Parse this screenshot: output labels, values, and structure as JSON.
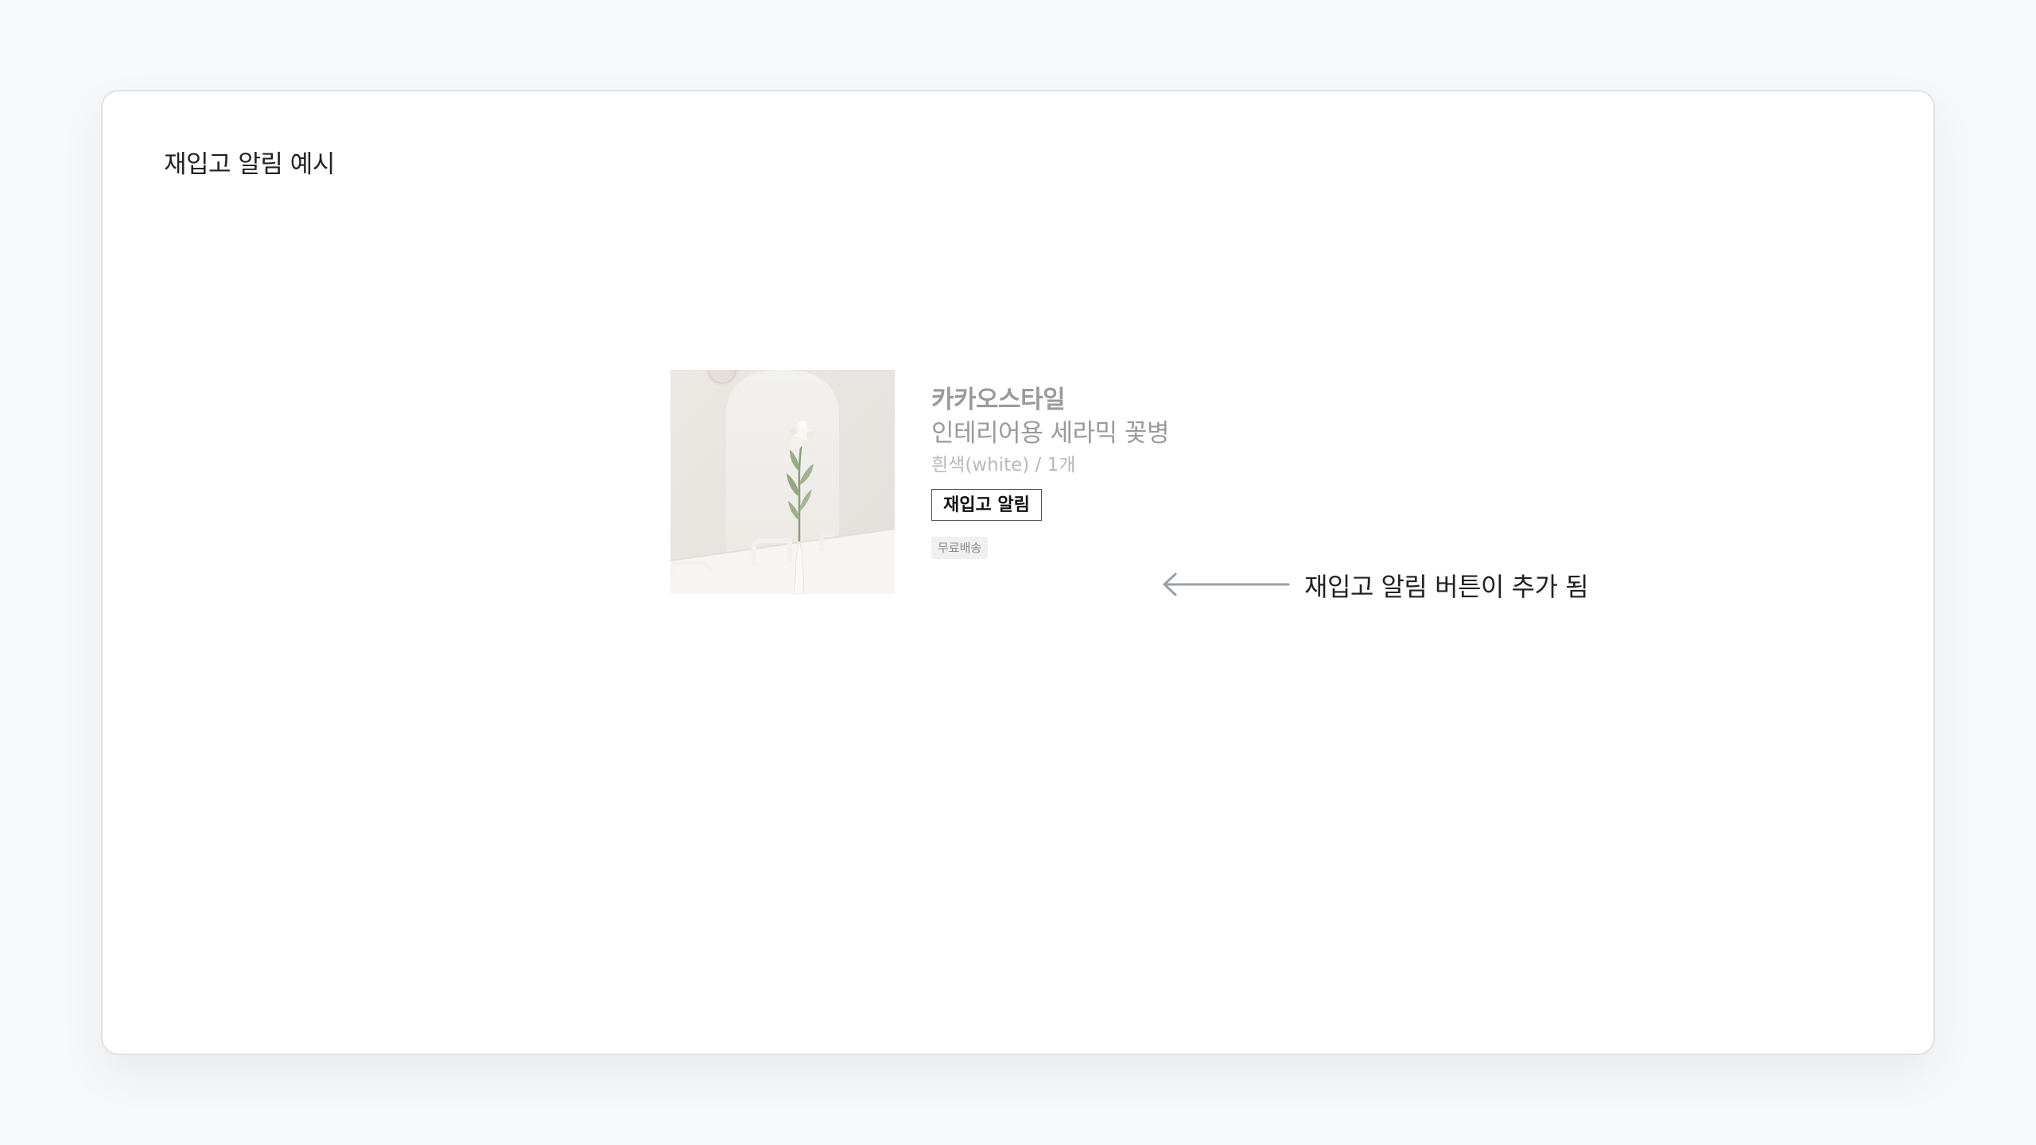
{
  "card": {
    "title": "재입고 알림 예시"
  },
  "product": {
    "brand": "카카오스타일",
    "name": "인테리어용 세라믹 꽃병",
    "option": "흰색(white) / 1개",
    "restock_button_label": "재입고 알림",
    "tag": "무료배송"
  },
  "annotation": {
    "text": "재입고 알림 버튼이 추가 됨"
  },
  "colors": {
    "page_background": "#f7f8fa",
    "card_background": "#ffffff",
    "muted_text": "#9a9a9a",
    "arrow": "#9aa0a6"
  },
  "icons": {
    "arrow": "arrow-left-icon",
    "product_image": "ceramic-vase-photo"
  }
}
